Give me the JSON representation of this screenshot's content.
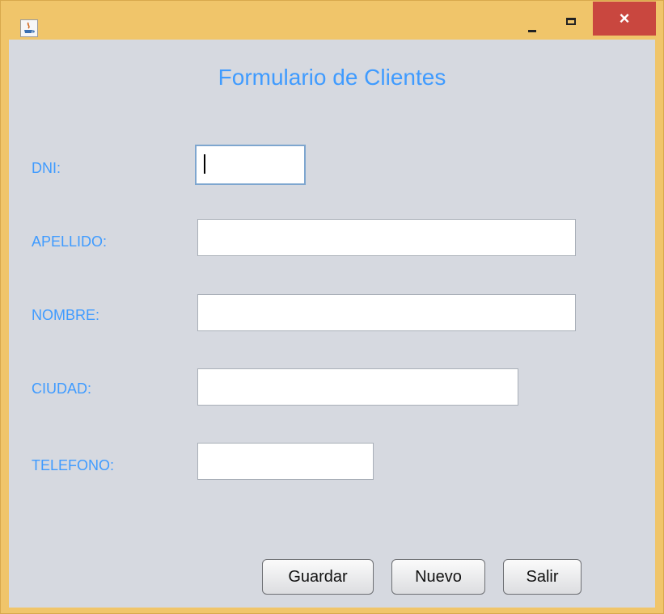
{
  "window": {
    "icon": "java-icon",
    "controls": {
      "minimize": "minimize-icon",
      "maximize": "maximize-icon",
      "close": "×"
    }
  },
  "form": {
    "title": "Formulario de Clientes",
    "fields": [
      {
        "label": "DNI:",
        "value": ""
      },
      {
        "label": "APELLIDO:",
        "value": ""
      },
      {
        "label": "NOMBRE:",
        "value": ""
      },
      {
        "label": "CIUDAD:",
        "value": ""
      },
      {
        "label": "TELEFONO:",
        "value": ""
      }
    ],
    "buttons": {
      "save": "Guardar",
      "new": "Nuevo",
      "exit": "Salir"
    }
  },
  "colors": {
    "titlebar": "#f0c56a",
    "client_bg": "#d6d9e0",
    "label_text": "#3f9bff",
    "close_button": "#c9473f"
  }
}
